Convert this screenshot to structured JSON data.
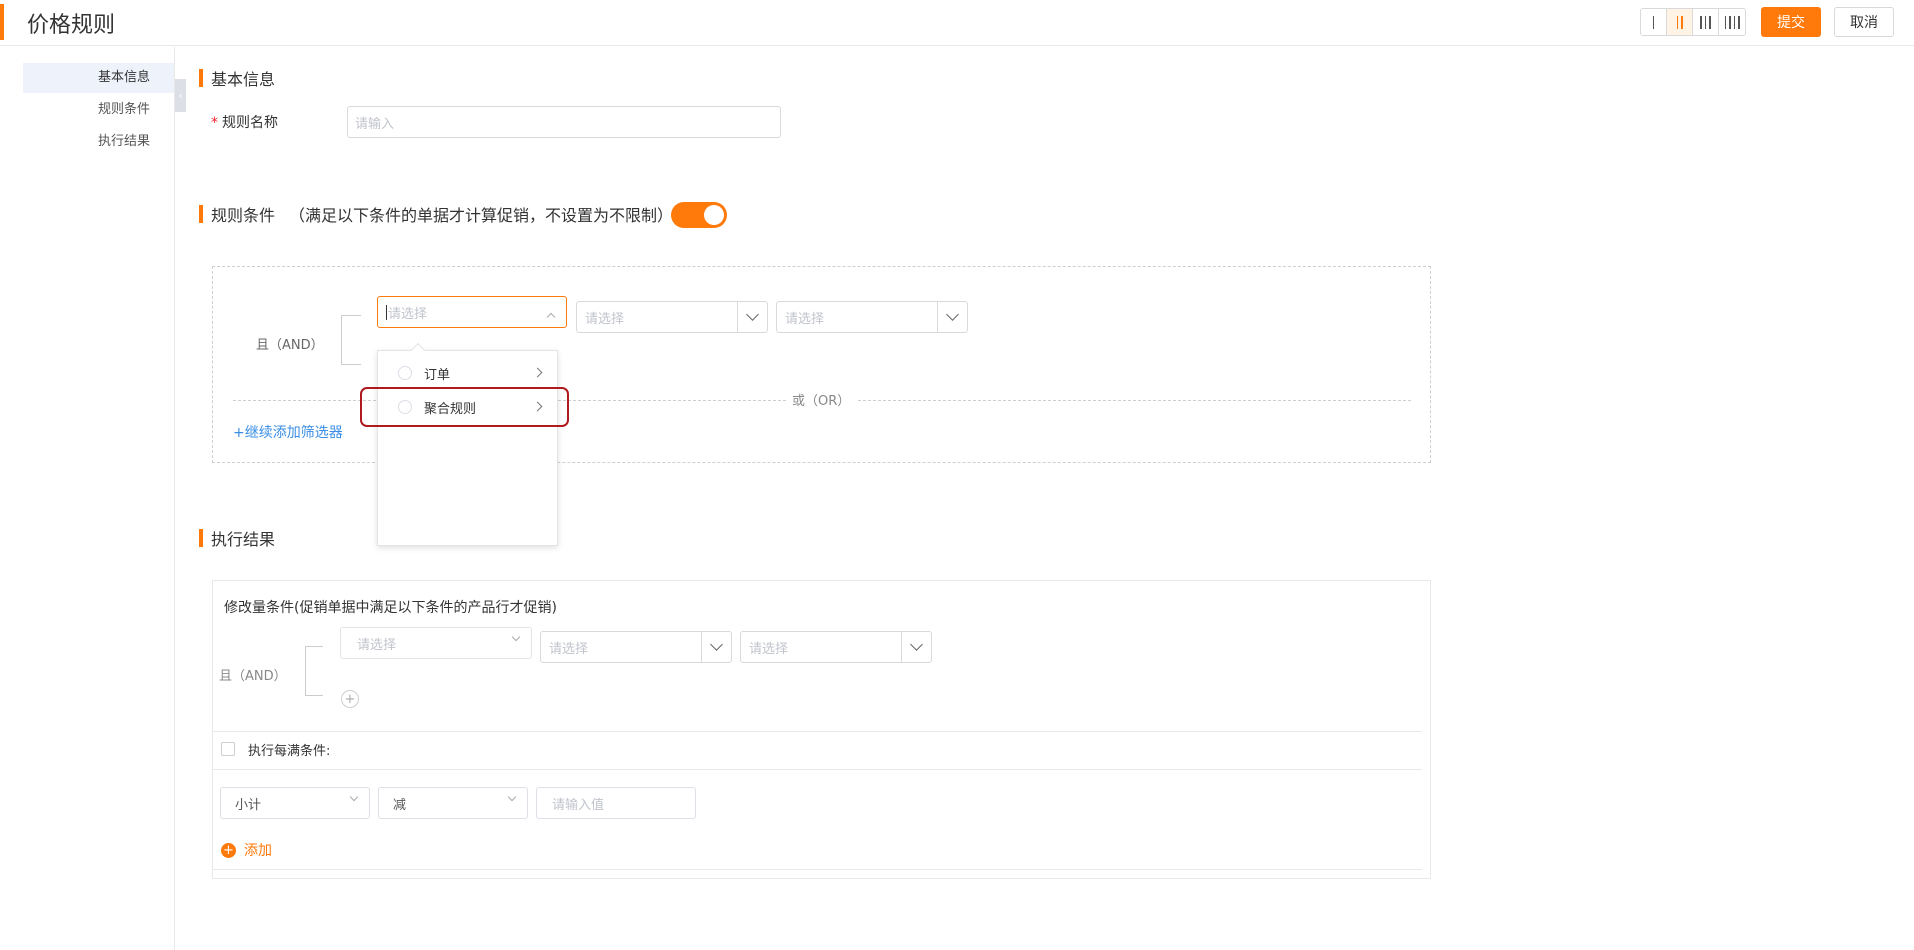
{
  "header": {
    "title": "价格规则",
    "layout_options": [
      "one-column",
      "two-column",
      "three-column",
      "four-column"
    ],
    "active_layout": "two-column",
    "submit_label": "提交",
    "cancel_label": "取消",
    "accent_color": "#ff7a0a"
  },
  "sidebar": {
    "items": [
      {
        "label": "基本信息",
        "active": true
      },
      {
        "label": "规则条件",
        "active": false
      },
      {
        "label": "执行结果",
        "active": false
      }
    ]
  },
  "basic_info": {
    "section_title": "基本信息",
    "rule_name_label": "规则名称",
    "rule_name_placeholder": "请输入"
  },
  "conditions": {
    "section_title": "规则条件",
    "section_note": "（满足以下条件的单据才计算促销，不设置为不限制）",
    "enabled": true,
    "and_label": "且（AND）",
    "or_label": "或（OR）",
    "select_placeholder": "请选择",
    "add_filter_label": "+继续添加筛选器",
    "dropdown_options": [
      {
        "label": "订单"
      },
      {
        "label": "聚合规则"
      }
    ]
  },
  "results": {
    "section_title": "执行结果",
    "modify_title": "修改量条件(促销单据中满足以下条件的产品行才促销)",
    "and_label": "且（AND）",
    "select_placeholder": "请选择",
    "each_full_label": "执行每满条件:",
    "subtotal_value": "小计",
    "reduce_value": "减",
    "value_placeholder": "请输入值",
    "add_label": "添加"
  }
}
